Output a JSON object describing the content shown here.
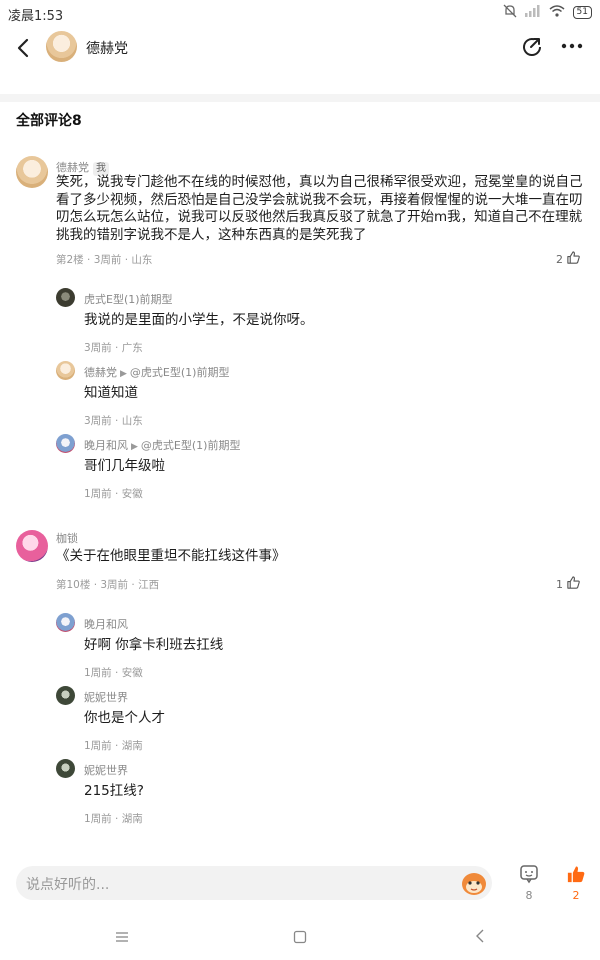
{
  "status_bar": {
    "time": "凌晨1:53",
    "battery": "51"
  },
  "header": {
    "title": "德赫党"
  },
  "comments_header": "全部评论8",
  "comments": [
    {
      "author": "德赫党",
      "badge": "我",
      "text": "笑死，说我专门趁他不在线的时候怼他，真以为自己很稀罕很受欢迎，冠冕堂皇的说自己看了多少视频，然后恐怕是自己没学会就说我不会玩，再接着假惺惺的说一大堆一直在叨叨怎么玩怎么站位，说我可以反驳他然后我真反驳了就急了开始m我，知道自己不在理就挑我的错别字说我不是人，这种东西真的是笑死我了",
      "meta": "第2楼 · 3周前 · 山东",
      "likes": "2",
      "replies": [
        {
          "author": "虎式E型(1)前期型",
          "reply_to": "",
          "text": "我说的是里面的小学生，不是说你呀。",
          "meta": "3周前 · 广东"
        },
        {
          "author": "德赫党",
          "reply_to": "@虎式E型(1)前期型",
          "text": "知道知道",
          "meta": "3周前 · 山东"
        },
        {
          "author": "晚月和风",
          "reply_to": "@虎式E型(1)前期型",
          "text": "哥们几年级啦",
          "meta": "1周前 · 安徽"
        }
      ]
    },
    {
      "author": "枷锁",
      "text": "《关于在他眼里重坦不能扛线这件事》",
      "meta": "第10楼 · 3周前 · 江西",
      "likes": "1",
      "replies": [
        {
          "author": "晚月和风",
          "text": "好啊 你拿卡利班去扛线",
          "meta": "1周前 · 安徽"
        },
        {
          "author": "妮妮世界",
          "text": "你也是个人才",
          "meta": "1周前 · 湖南"
        },
        {
          "author": "妮妮世界",
          "text": "215扛线?",
          "meta": "1周前 · 湖南"
        }
      ]
    }
  ],
  "bottom_bar": {
    "input_placeholder": "说点好听的...",
    "comment_count": "8",
    "like_count": "2",
    "like_color": "#ff6a13"
  }
}
